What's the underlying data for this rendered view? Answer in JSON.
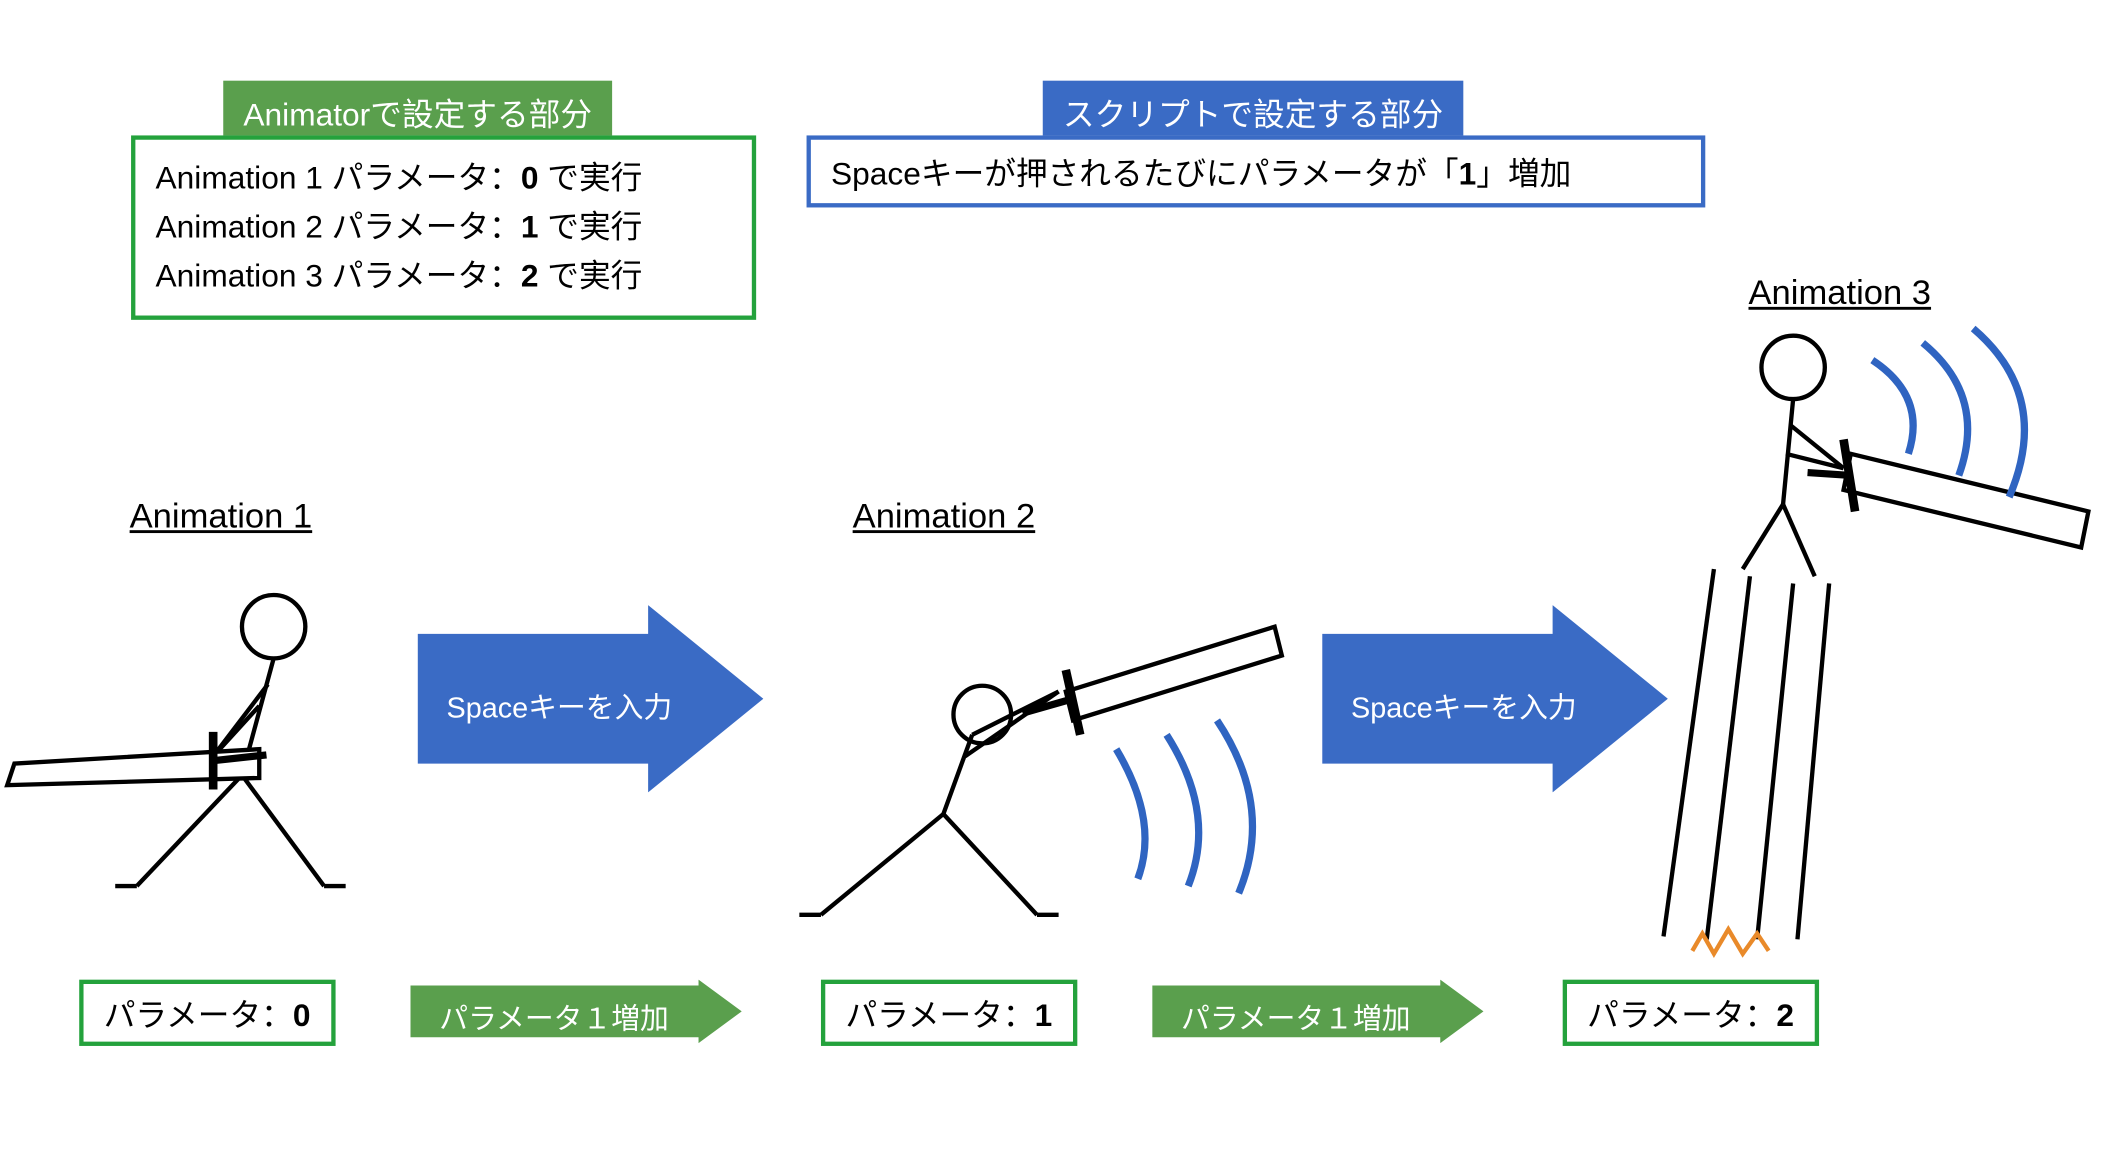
{
  "headers": {
    "animator_title": "Animatorで設定する部分",
    "animator_lines": [
      "Animation 1 パラメータ：<b>0</b> で実行",
      "Animation 2 パラメータ：<b>1</b> で実行",
      "Animation 3 パラメータ：<b>2</b> で実行"
    ],
    "script_title": "スクリプトで設定する部分",
    "script_line": "Spaceキーが押されるたびにパラメータが「<b>1</b>」増加"
  },
  "labels": {
    "anim1": "Animation 1",
    "anim2": "Animation 2",
    "anim3": "Animation 3"
  },
  "arrows": {
    "to2": "Spaceキーを入力",
    "to3": "Spaceキーを入力"
  },
  "params": {
    "p0": "パラメータ：<b>0</b>",
    "p1": "パラメータ：<b>1</b>",
    "p2": "パラメータ：<b>2</b>",
    "inc": "パラメータ１増加"
  }
}
